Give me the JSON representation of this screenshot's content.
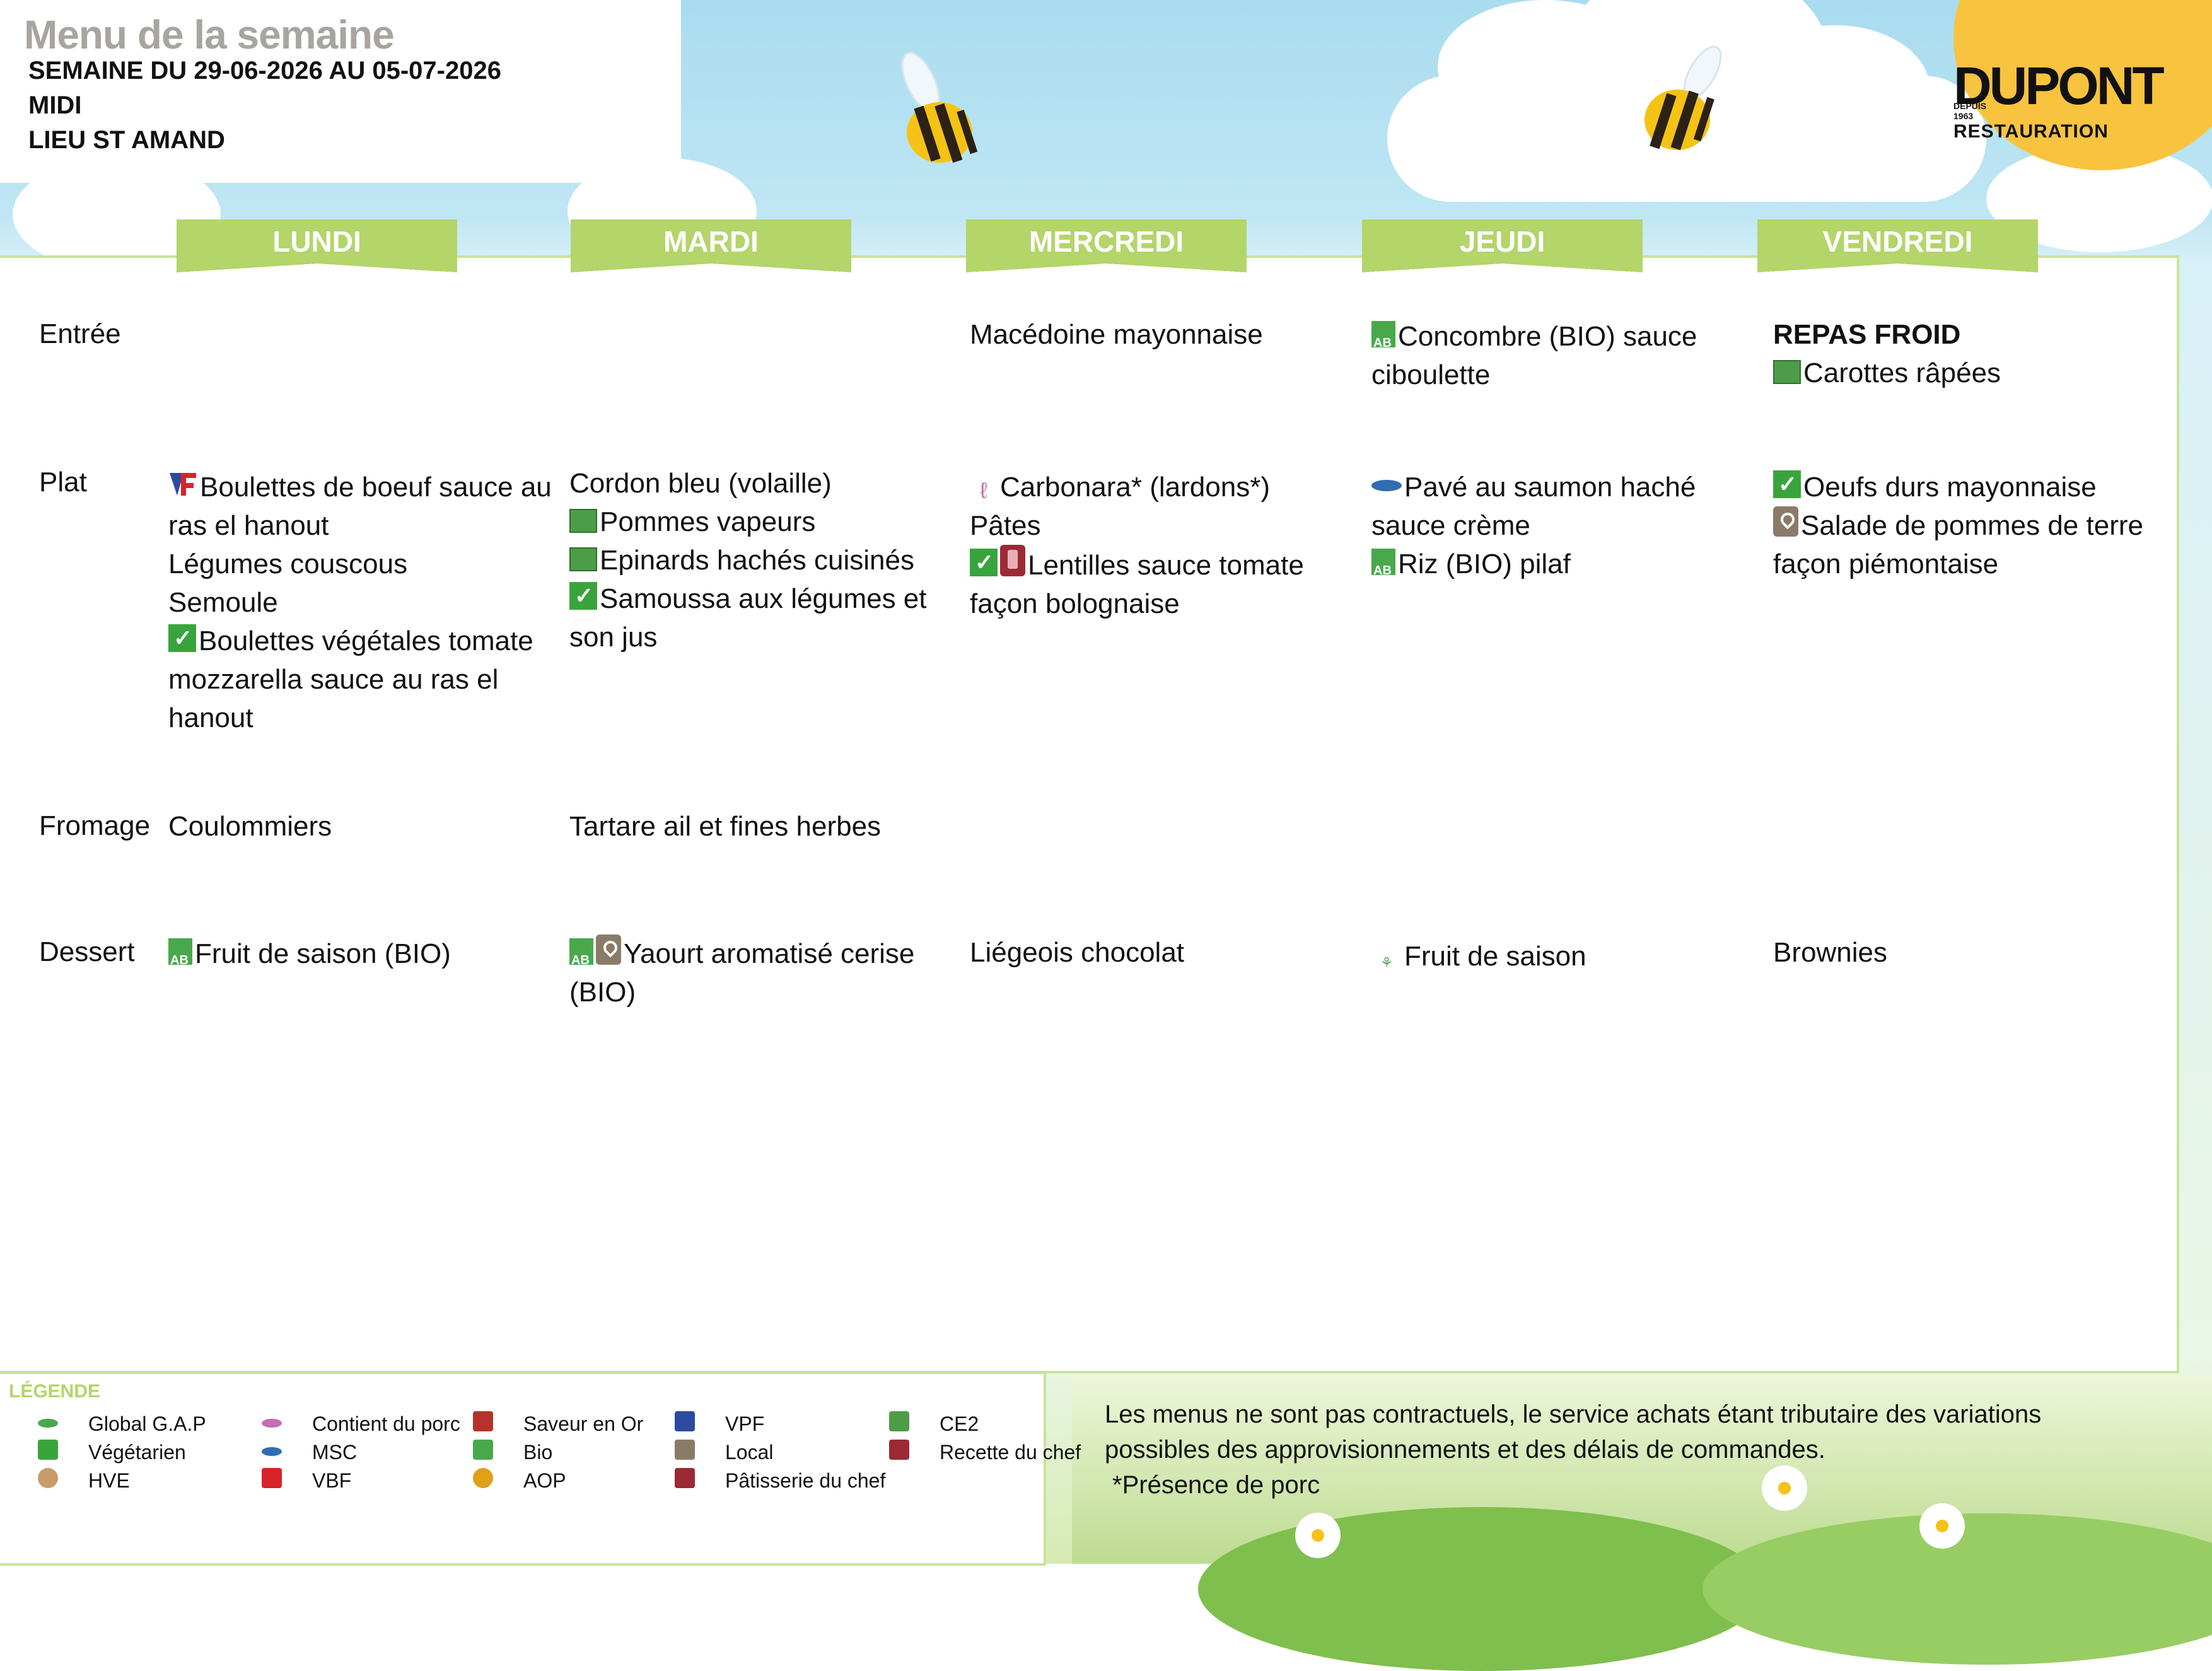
{
  "header": {
    "title": "Menu de la semaine",
    "week": "SEMAINE DU 29-06-2026 AU 05-07-2026",
    "service": "MIDI",
    "place": "LIEU ST AMAND"
  },
  "logo": {
    "name": "DUPONT",
    "tagline_depuis": "DEPUIS",
    "tagline_year": "1963",
    "sub": "RESTAURATION"
  },
  "days": [
    "LUNDI",
    "MARDI",
    "MERCREDI",
    "JEUDI",
    "VENDREDI"
  ],
  "categories": [
    "Entrée",
    "Plat",
    "Fromage",
    "Dessert"
  ],
  "menu": {
    "entree": {
      "lundi": [],
      "mardi": [],
      "mercredi": [
        {
          "text": "Macédoine mayonnaise",
          "icons": []
        }
      ],
      "jeudi": [
        {
          "text": "Concombre (BIO) sauce ciboulette",
          "icons": [
            "bio-icon"
          ]
        }
      ],
      "vendredi": [
        {
          "text": "REPAS FROID",
          "icons": [],
          "bold": true
        },
        {
          "text": "Carottes râpées",
          "icons": [
            "ce2-icon"
          ]
        }
      ]
    },
    "plat": {
      "lundi": [
        {
          "text": "Boulettes de boeuf sauce au ras el hanout",
          "icons": [
            "vbf-icon"
          ]
        },
        {
          "text": "Légumes couscous",
          "icons": []
        },
        {
          "text": "Semoule",
          "icons": []
        },
        {
          "text": "Boulettes végétales tomate mozzarella sauce au ras el hanout",
          "icons": [
            "vegetarian-icon"
          ]
        }
      ],
      "mardi": [
        {
          "text": "Cordon bleu (volaille)",
          "icons": []
        },
        {
          "text": "Pommes vapeurs",
          "icons": [
            "ce2-icon"
          ]
        },
        {
          "text": "Epinards hachés cuisinés",
          "icons": [
            "ce2-icon"
          ]
        },
        {
          "text": "Samoussa aux légumes et son jus",
          "icons": [
            "vegetarian-icon"
          ]
        }
      ],
      "mercredi": [
        {
          "text": "Carbonara* (lardons*)",
          "icons": [
            "pork-icon"
          ]
        },
        {
          "text": "Pâtes",
          "icons": []
        },
        {
          "text": "Lentilles sauce tomate façon bolognaise",
          "icons": [
            "vegetarian-icon",
            "chef-recipe-icon"
          ]
        }
      ],
      "jeudi": [
        {
          "text": "Pavé au saumon haché sauce crème",
          "icons": [
            "msc-icon"
          ]
        },
        {
          "text": "Riz (BIO) pilaf",
          "icons": [
            "bio-icon"
          ]
        }
      ],
      "vendredi": [
        {
          "text": "Oeufs durs mayonnaise",
          "icons": [
            "vegetarian-icon"
          ]
        },
        {
          "text": "Salade de pommes de terre façon piémontaise",
          "icons": [
            "local-icon"
          ]
        }
      ]
    },
    "fromage": {
      "lundi": [
        {
          "text": "Coulommiers",
          "icons": []
        }
      ],
      "mardi": [
        {
          "text": "Tartare ail et fines herbes",
          "icons": []
        }
      ],
      "mercredi": [],
      "jeudi": [],
      "vendredi": []
    },
    "dessert": {
      "lundi": [
        {
          "text": "Fruit de saison (BIO)",
          "icons": [
            "bio-icon"
          ]
        }
      ],
      "mardi": [
        {
          "text": "Yaourt aromatisé cerise (BIO)",
          "icons": [
            "bio-icon",
            "local-icon"
          ]
        }
      ],
      "mercredi": [
        {
          "text": "Liégeois chocolat",
          "icons": []
        }
      ],
      "jeudi": [
        {
          "text": "Fruit de saison",
          "icons": [
            "global-gap-icon"
          ]
        }
      ],
      "vendredi": [
        {
          "text": "Brownies",
          "icons": []
        }
      ]
    }
  },
  "legend": {
    "title": "LÉGENDE",
    "items": [
      {
        "label": "Global G.A.P",
        "icon": "global-gap-icon"
      },
      {
        "label": "Végétarien",
        "icon": "vegetarian-icon"
      },
      {
        "label": "HVE",
        "icon": "hve-icon"
      },
      {
        "label": "Contient du porc",
        "icon": "pork-icon"
      },
      {
        "label": "MSC",
        "icon": "msc-icon"
      },
      {
        "label": "VBF",
        "icon": "vbf-icon"
      },
      {
        "label": "Saveur en Or",
        "icon": "saveur-en-or-icon"
      },
      {
        "label": "Bio",
        "icon": "bio-icon"
      },
      {
        "label": "AOP",
        "icon": "aop-icon"
      },
      {
        "label": "VPF",
        "icon": "vpf-icon"
      },
      {
        "label": "Local",
        "icon": "local-icon"
      },
      {
        "label": "Pâtisserie du chef",
        "icon": "pastry-chef-icon"
      },
      {
        "label": "CE2",
        "icon": "ce2-icon"
      },
      {
        "label": "Recette du chef",
        "icon": "chef-recipe-icon"
      }
    ]
  },
  "disclaimer": {
    "text": "Les menus ne sont pas contractuels, le service achats étant tributaire des variations possibles des approvisionnements et des délais de commandes.",
    "pork_note": "*Présence de porc"
  },
  "colors": {
    "tab_green": "#b3d56a",
    "border_green": "#c9e39a",
    "sun_yellow": "#f8c33f",
    "sky": "#a9dcef",
    "title_grey": "#a8a5a0"
  }
}
